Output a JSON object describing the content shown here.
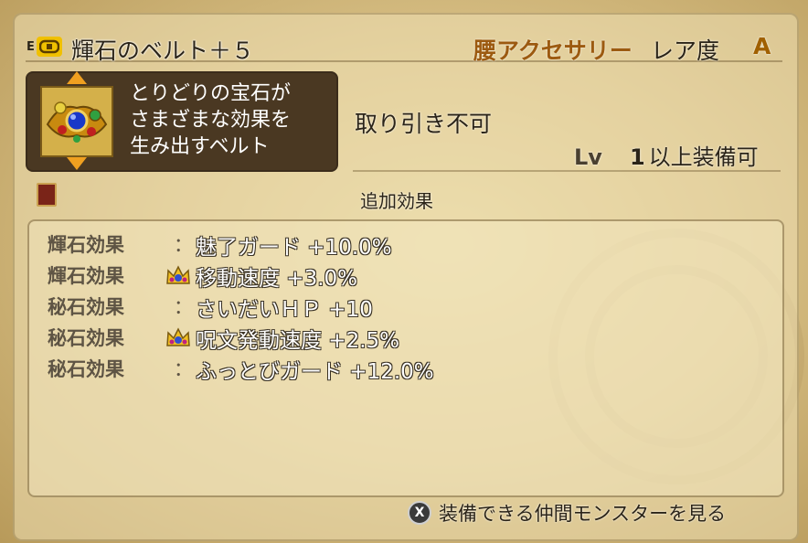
{
  "item": {
    "equipped_mark": "E",
    "name": "輝石のベルト＋５",
    "category": "腰アクセサリー",
    "rarity_label": "レア度",
    "rarity_value": "A"
  },
  "description": {
    "lines": [
      "とりどりの宝石が",
      "さまざまな効果を",
      "生み出すベルト"
    ]
  },
  "trade_status": "取り引き不可",
  "level_requirement": {
    "label": "Lv",
    "value": "1",
    "suffix": "以上装備可"
  },
  "effects_section": {
    "title": "追加効果",
    "rows": [
      {
        "label": "輝石効果",
        "separator": "：",
        "icon": "none",
        "text": "魅了ガード +10.0%"
      },
      {
        "label": "輝石効果",
        "separator": "",
        "icon": "crown-icon",
        "text": "移動速度 +3.0%"
      },
      {
        "label": "秘石効果",
        "separator": "：",
        "icon": "none",
        "text": "さいだいＨＰ +10"
      },
      {
        "label": "秘石効果",
        "separator": "",
        "icon": "crown-icon",
        "text": "呪文発動速度 +2.5%"
      },
      {
        "label": "秘石効果",
        "separator": "：",
        "icon": "none",
        "text": "ふっとびガード +12.0%"
      }
    ]
  },
  "footer": {
    "button": "X",
    "text": "装備できる仲間モンスターを見る"
  },
  "colors": {
    "category": "#9c5a10",
    "rarity": "#a06000",
    "desc_bg": "#4a3822",
    "badge": "#f0c000"
  }
}
